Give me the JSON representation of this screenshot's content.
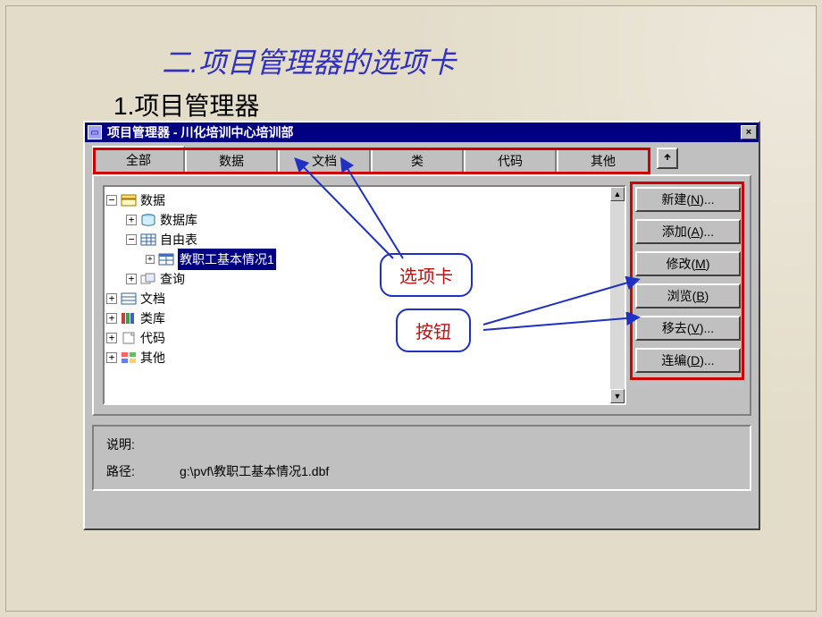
{
  "slide": {
    "title": "二.项目管理器的选项卡",
    "subtitle": "1.项目管理器"
  },
  "window": {
    "title": "项目管理器 - 川化培训中心培训部",
    "close_symbol": "×"
  },
  "tabs": [
    "全部",
    "数据",
    "文档",
    "类",
    "代码",
    "其他"
  ],
  "tree": {
    "root": "数据",
    "n_database": "数据库",
    "n_freetable": "自由表",
    "n_selected": "教职工基本情况1",
    "n_query": "查询",
    "n_doc": "文档",
    "n_classlib": "类库",
    "n_code": "代码",
    "n_other": "其他"
  },
  "buttons": {
    "new": {
      "label": "新建",
      "key": "N",
      "suffix": "..."
    },
    "add": {
      "label": "添加",
      "key": "A",
      "suffix": "..."
    },
    "modify": {
      "label": "修改",
      "key": "M",
      "suffix": ""
    },
    "browse": {
      "label": "浏览",
      "key": "B",
      "suffix": ""
    },
    "remove": {
      "label": "移去",
      "key": "V",
      "suffix": "..."
    },
    "build": {
      "label": "连编",
      "key": "D",
      "suffix": "..."
    }
  },
  "footer": {
    "desc_label": "说明:",
    "path_label": "路径:",
    "path_value": "g:\\pvf\\教职工基本情况1.dbf"
  },
  "callouts": {
    "tabs": "选项卡",
    "buttons": "按钮"
  }
}
